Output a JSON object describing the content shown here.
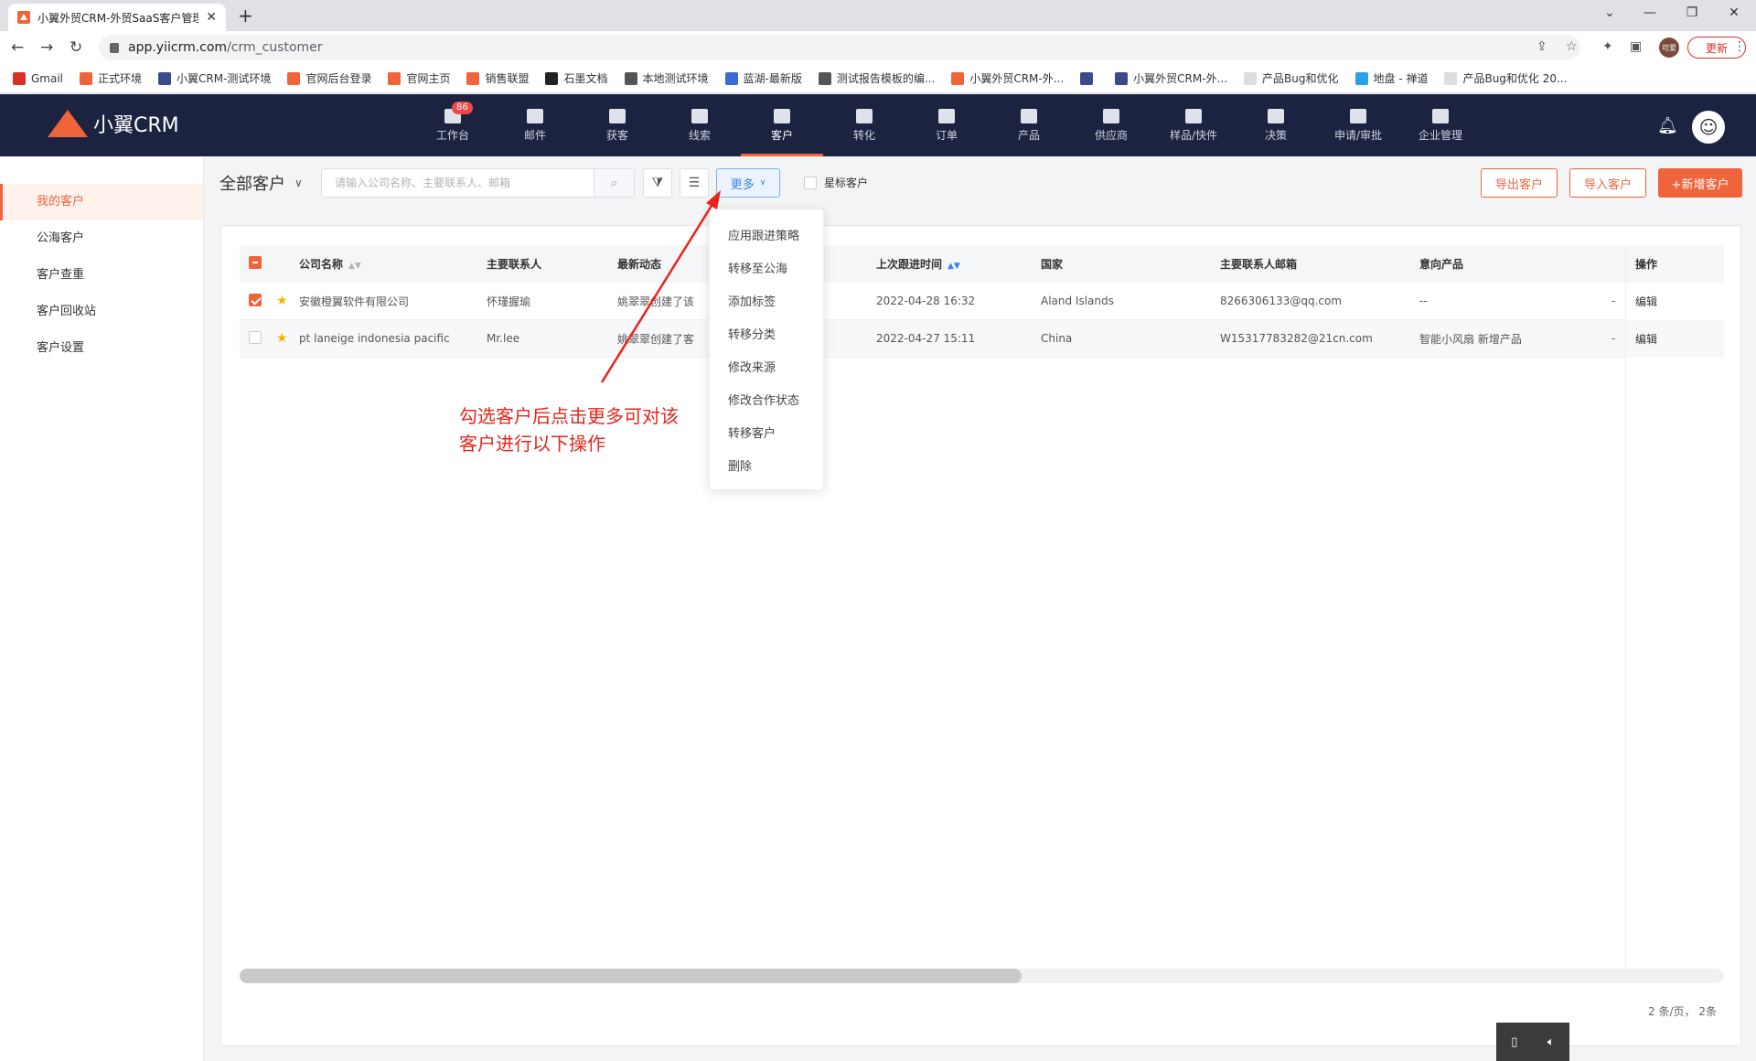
{
  "browser": {
    "tab_title": "小翼外贸CRM-外贸SaaS客户管理",
    "new_tab": "+",
    "url_host": "app.yiicrm.com",
    "url_path": "/crm_customer",
    "update_label": "更新",
    "profile_label": "可爱",
    "bookmarks": [
      "Gmail",
      "正式环境",
      "小翼CRM-测试环境",
      "官网后台登录",
      "官网主页",
      "销售联盟",
      "石墨文档",
      "本地测试环境",
      "蓝湖-最新版",
      "测试报告模板的编...",
      "小翼外贸CRM-外...",
      "",
      "小翼外贸CRM-外...",
      "产品Bug和优化",
      "地盘 - 禅道",
      "产品Bug和优化 20..."
    ]
  },
  "header": {
    "logo_text": "小翼CRM",
    "nav": [
      {
        "label": "工作台",
        "badge": "86"
      },
      {
        "label": "邮件"
      },
      {
        "label": "获客"
      },
      {
        "label": "线索"
      },
      {
        "label": "客户"
      },
      {
        "label": "转化"
      },
      {
        "label": "订单"
      },
      {
        "label": "产品"
      },
      {
        "label": "供应商"
      },
      {
        "label": "样品/快件"
      },
      {
        "label": "决策"
      },
      {
        "label": "申请/审批"
      },
      {
        "label": "企业管理"
      }
    ],
    "active_nav": "客户"
  },
  "sidebar": {
    "items": [
      "我的客户",
      "公海客户",
      "客户查重",
      "客户回收站",
      "客户设置"
    ],
    "active": "我的客户"
  },
  "toolbar": {
    "scope_label": "全部客户",
    "search_placeholder": "请输入公司名称、主要联系人、邮箱",
    "more_label": "更多",
    "star_filter_label": "星标客户",
    "export_label": "导出客户",
    "import_label": "导入客户",
    "add_label": "+新增客户"
  },
  "table": {
    "columns": [
      "公司名称",
      "主要联系人",
      "最新动态",
      "上次跟进时间",
      "国家",
      "主要联系人邮箱",
      "意向产品",
      "操作"
    ],
    "rows": [
      {
        "checked": true,
        "company": "安徽橙翼软件有限公司",
        "contact": "怀瑾握瑜",
        "activity": "姚翠翠创建了该",
        "last_follow": "2022-04-28 16:32",
        "country": "Aland Islands",
        "email": "8266306133@qq.com",
        "product": "--",
        "extra": "-",
        "action": "编辑"
      },
      {
        "checked": false,
        "company": "pt laneige indonesia pacific",
        "contact": "Mr.lee",
        "activity": "姚翠翠创建了客",
        "last_follow": "2022-04-27 15:11",
        "country": "China",
        "email": "W15317783282@21cn.com",
        "product": "智能小风扇 新增产品",
        "extra": "-",
        "action": "编辑"
      }
    ],
    "pagination": "2 条/页， 2条"
  },
  "more_menu": {
    "items": [
      "应用跟进策略",
      "转移至公海",
      "添加标签",
      "转移分类",
      "修改来源",
      "修改合作状态",
      "转移客户",
      "删除"
    ]
  },
  "annotation": {
    "line1": "勾选客户后点击更多可对该",
    "line2": "客户进行以下操作",
    "color": "#e8241b"
  },
  "colors": {
    "accent": "#f0643c",
    "header_bg": "#1b2340",
    "link_blue": "#3a82f0"
  }
}
